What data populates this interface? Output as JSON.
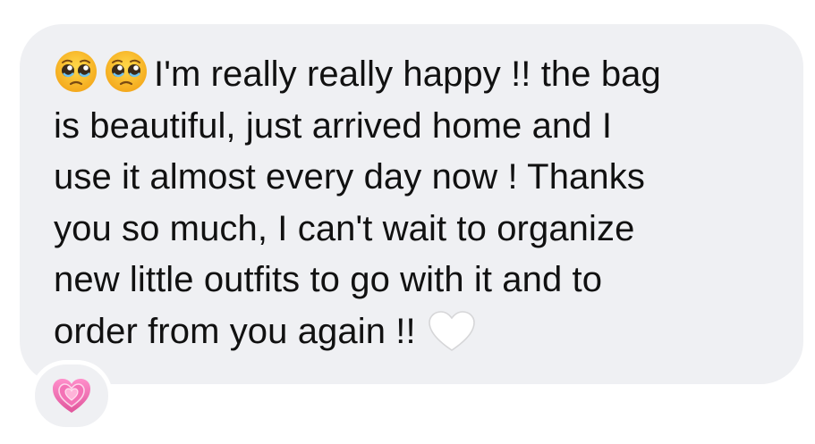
{
  "message": {
    "emojis_leading": [
      "pleading-face-icon",
      "pleading-face-icon"
    ],
    "lines": [
      "I'm really really happy !! the bag",
      "is beautiful, just arrived home and I",
      "use it almost every day now ! Thanks",
      "you so much, I can't wait to organize",
      "new little outfits to go with it and to",
      "order from you again !!"
    ],
    "trailing_emoji": "white-heart-icon"
  },
  "reaction": {
    "emoji": "growing-heart-icon"
  },
  "colors": {
    "bubble_background": "#eff0f3",
    "text": "#111111",
    "reaction_heart": "#f06bb0",
    "white_heart": "#ffffff"
  }
}
